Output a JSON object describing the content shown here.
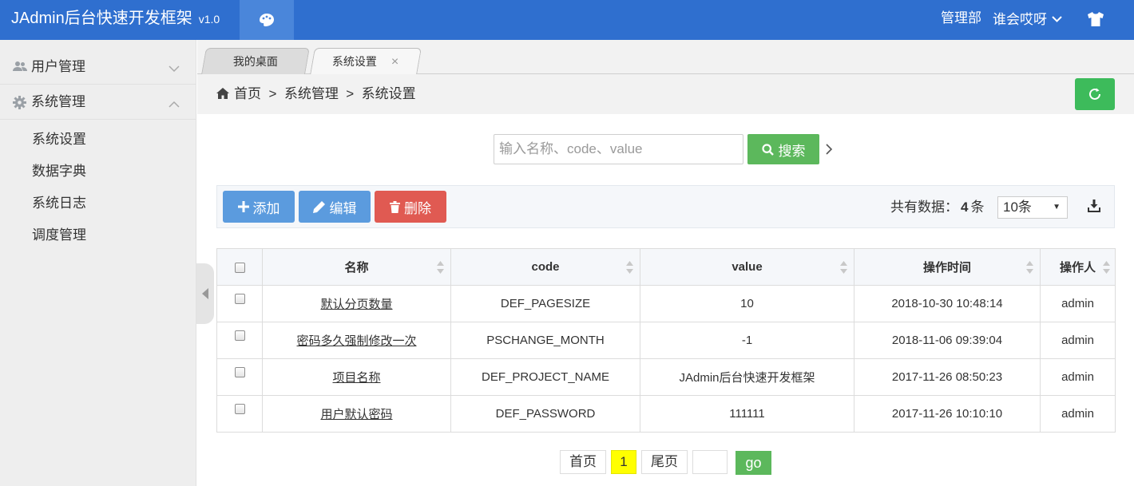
{
  "header": {
    "brand": "JAdmin后台快速开发框架",
    "version": "v1.0",
    "department": "管理部",
    "username": "谁会哎呀"
  },
  "sidebar": {
    "menus": [
      {
        "label": "用户管理",
        "icon": "users-icon",
        "expanded": false
      },
      {
        "label": "系统管理",
        "icon": "gear-icon",
        "expanded": true
      }
    ],
    "submenu": [
      "系统设置",
      "数据字典",
      "系统日志",
      "调度管理"
    ]
  },
  "tabs": [
    {
      "label": "我的桌面"
    },
    {
      "label": "系统设置",
      "close": "×"
    }
  ],
  "breadcrumb": {
    "text": "首页  >  系统管理  >  系统设置"
  },
  "search": {
    "placeholder": "输入名称、code、value",
    "button_label": "搜索"
  },
  "toolbar": {
    "add_label": "添加",
    "edit_label": "编辑",
    "delete_label": "删除",
    "total_prefix": "共有数据：",
    "total_count": "4",
    "total_suffix": "条",
    "page_size": "10条"
  },
  "table": {
    "columns": [
      "名称",
      "code",
      "value",
      "操作时间",
      "操作人"
    ],
    "rows": [
      {
        "name": "默认分页数量",
        "code": "DEF_PAGESIZE",
        "value": "10",
        "time": "2018-10-30 10:48:14",
        "operator": "admin"
      },
      {
        "name": "密码多久强制修改一次",
        "code": "PSCHANGE_MONTH",
        "value": "-1",
        "time": "2018-11-06 09:39:04",
        "operator": "admin"
      },
      {
        "name": "项目名称",
        "code": "DEF_PROJECT_NAME",
        "value": "JAdmin后台快速开发框架",
        "time": "2017-11-26 08:50:23",
        "operator": "admin"
      },
      {
        "name": "用户默认密码",
        "code": "DEF_PASSWORD",
        "value": "111111",
        "time": "2017-11-26 10:10:10",
        "operator": "admin"
      }
    ]
  },
  "pagination": {
    "first": "首页",
    "current": "1",
    "last": "尾页",
    "go": "go"
  },
  "colors": {
    "header": "#2f6fcf",
    "success": "#5cb85c",
    "primary": "#5b9bde",
    "danger": "#e05a52",
    "current_page": "#ffff00"
  }
}
